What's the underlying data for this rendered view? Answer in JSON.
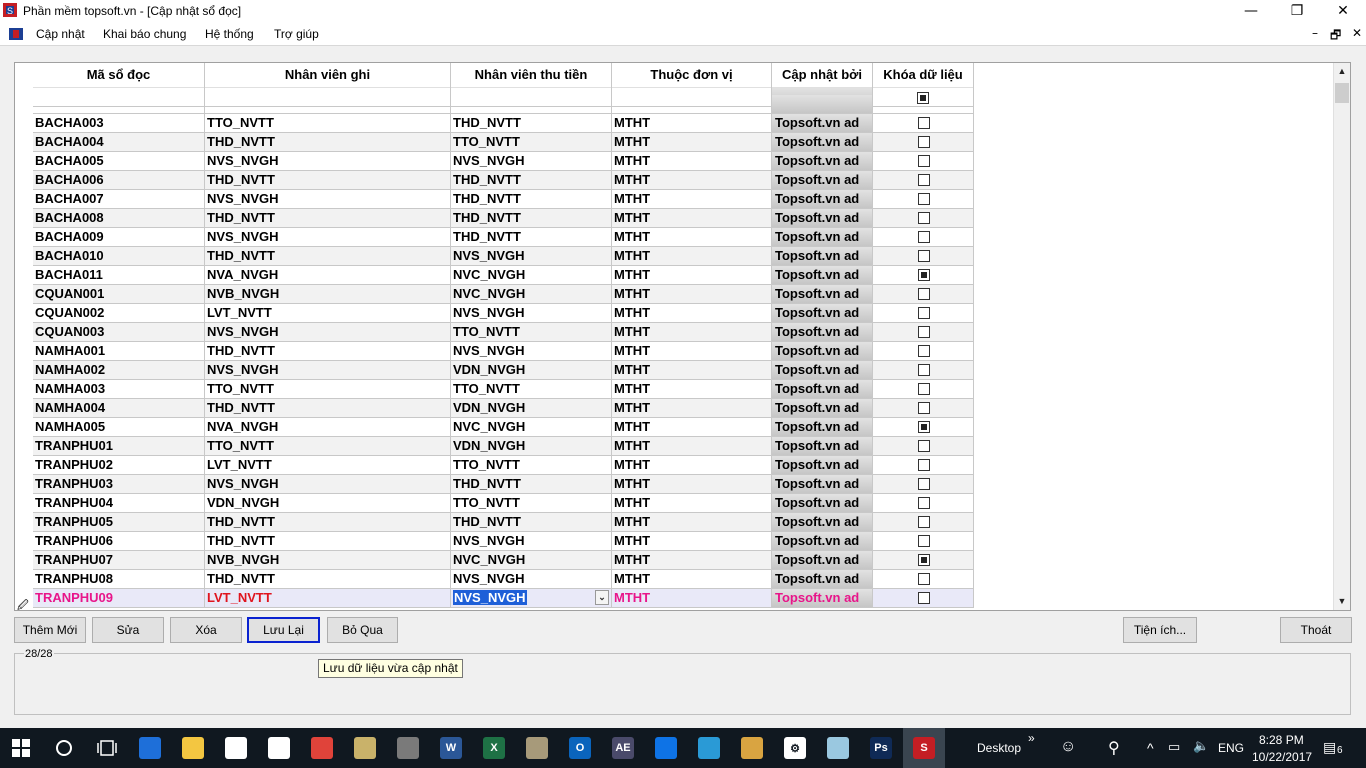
{
  "window": {
    "title": "Phần mềm topsoft.vn - [Cập nhật sổ đọc]",
    "minimize": "—",
    "restore": "❐",
    "close": "✕"
  },
  "menu": {
    "items": [
      "Cập nhật",
      "Khai báo chung",
      "Hệ thống",
      "Trợ giúp"
    ],
    "mdi_minimize": "–",
    "mdi_restore": "🗗",
    "mdi_close": "✕"
  },
  "grid": {
    "columns": [
      "Mã sổ đọc",
      "Nhân viên ghi",
      "Nhân viên thu tiền",
      "Thuộc đơn vị",
      "Cập nhật bởi",
      "Khóa dữ liệu"
    ],
    "header_lock_checked": true,
    "rows": [
      {
        "ma": "BACHA003",
        "nvghi": "TTO_NVTT",
        "nvthu": "THD_NVTT",
        "donvi": "MTHT",
        "capnhat": "Topsoft.vn ad",
        "khoa": false
      },
      {
        "ma": "BACHA004",
        "nvghi": "THD_NVTT",
        "nvthu": "TTO_NVTT",
        "donvi": "MTHT",
        "capnhat": "Topsoft.vn ad",
        "khoa": false
      },
      {
        "ma": "BACHA005",
        "nvghi": "NVS_NVGH",
        "nvthu": "NVS_NVGH",
        "donvi": "MTHT",
        "capnhat": "Topsoft.vn ad",
        "khoa": false
      },
      {
        "ma": "BACHA006",
        "nvghi": "THD_NVTT",
        "nvthu": "THD_NVTT",
        "donvi": "MTHT",
        "capnhat": "Topsoft.vn ad",
        "khoa": false
      },
      {
        "ma": "BACHA007",
        "nvghi": "NVS_NVGH",
        "nvthu": "THD_NVTT",
        "donvi": "MTHT",
        "capnhat": "Topsoft.vn ad",
        "khoa": false
      },
      {
        "ma": "BACHA008",
        "nvghi": "THD_NVTT",
        "nvthu": "THD_NVTT",
        "donvi": "MTHT",
        "capnhat": "Topsoft.vn ad",
        "khoa": false
      },
      {
        "ma": "BACHA009",
        "nvghi": "NVS_NVGH",
        "nvthu": "THD_NVTT",
        "donvi": "MTHT",
        "capnhat": "Topsoft.vn ad",
        "khoa": false
      },
      {
        "ma": "BACHA010",
        "nvghi": "THD_NVTT",
        "nvthu": "NVS_NVGH",
        "donvi": "MTHT",
        "capnhat": "Topsoft.vn ad",
        "khoa": false
      },
      {
        "ma": "BACHA011",
        "nvghi": "NVA_NVGH",
        "nvthu": "NVC_NVGH",
        "donvi": "MTHT",
        "capnhat": "Topsoft.vn ad",
        "khoa": true
      },
      {
        "ma": "CQUAN001",
        "nvghi": "NVB_NVGH",
        "nvthu": "NVC_NVGH",
        "donvi": "MTHT",
        "capnhat": "Topsoft.vn ad",
        "khoa": false
      },
      {
        "ma": "CQUAN002",
        "nvghi": "LVT_NVTT",
        "nvthu": "NVS_NVGH",
        "donvi": "MTHT",
        "capnhat": "Topsoft.vn ad",
        "khoa": false
      },
      {
        "ma": "CQUAN003",
        "nvghi": "NVS_NVGH",
        "nvthu": "TTO_NVTT",
        "donvi": "MTHT",
        "capnhat": "Topsoft.vn ad",
        "khoa": false
      },
      {
        "ma": "NAMHA001",
        "nvghi": "THD_NVTT",
        "nvthu": "NVS_NVGH",
        "donvi": "MTHT",
        "capnhat": "Topsoft.vn ad",
        "khoa": false
      },
      {
        "ma": "NAMHA002",
        "nvghi": "NVS_NVGH",
        "nvthu": "VDN_NVGH",
        "donvi": "MTHT",
        "capnhat": "Topsoft.vn ad",
        "khoa": false
      },
      {
        "ma": "NAMHA003",
        "nvghi": "TTO_NVTT",
        "nvthu": "TTO_NVTT",
        "donvi": "MTHT",
        "capnhat": "Topsoft.vn ad",
        "khoa": false
      },
      {
        "ma": "NAMHA004",
        "nvghi": "THD_NVTT",
        "nvthu": "VDN_NVGH",
        "donvi": "MTHT",
        "capnhat": "Topsoft.vn ad",
        "khoa": false
      },
      {
        "ma": "NAMHA005",
        "nvghi": "NVA_NVGH",
        "nvthu": "NVC_NVGH",
        "donvi": "MTHT",
        "capnhat": "Topsoft.vn ad",
        "khoa": true
      },
      {
        "ma": "TRANPHU01",
        "nvghi": "TTO_NVTT",
        "nvthu": "VDN_NVGH",
        "donvi": "MTHT",
        "capnhat": "Topsoft.vn ad",
        "khoa": false
      },
      {
        "ma": "TRANPHU02",
        "nvghi": "LVT_NVTT",
        "nvthu": "TTO_NVTT",
        "donvi": "MTHT",
        "capnhat": "Topsoft.vn ad",
        "khoa": false
      },
      {
        "ma": "TRANPHU03",
        "nvghi": "NVS_NVGH",
        "nvthu": "THD_NVTT",
        "donvi": "MTHT",
        "capnhat": "Topsoft.vn ad",
        "khoa": false
      },
      {
        "ma": "TRANPHU04",
        "nvghi": "VDN_NVGH",
        "nvthu": "TTO_NVTT",
        "donvi": "MTHT",
        "capnhat": "Topsoft.vn ad",
        "khoa": false
      },
      {
        "ma": "TRANPHU05",
        "nvghi": "THD_NVTT",
        "nvthu": "THD_NVTT",
        "donvi": "MTHT",
        "capnhat": "Topsoft.vn ad",
        "khoa": false
      },
      {
        "ma": "TRANPHU06",
        "nvghi": "THD_NVTT",
        "nvthu": "NVS_NVGH",
        "donvi": "MTHT",
        "capnhat": "Topsoft.vn ad",
        "khoa": false
      },
      {
        "ma": "TRANPHU07",
        "nvghi": "NVB_NVGH",
        "nvthu": "NVC_NVGH",
        "donvi": "MTHT",
        "capnhat": "Topsoft.vn ad",
        "khoa": true
      },
      {
        "ma": "TRANPHU08",
        "nvghi": "THD_NVTT",
        "nvthu": "NVS_NVGH",
        "donvi": "MTHT",
        "capnhat": "Topsoft.vn ad",
        "khoa": false
      }
    ],
    "current_row": {
      "ma": "TRANPHU09",
      "nvghi": "LVT_NVTT",
      "nvthu": "NVS_NVGH",
      "donvi": "MTHT",
      "capnhat": "Topsoft.vn ad",
      "khoa": false
    },
    "row_indicator": "🖉"
  },
  "buttons": {
    "add": "Thêm Mới",
    "edit": "Sửa",
    "delete": "Xóa",
    "save": "Lưu Lại",
    "skip": "Bỏ Qua",
    "utilities": "Tiện ích...",
    "exit": "Thoát"
  },
  "status": {
    "count": "28/28"
  },
  "tooltip": "Lưu dữ liệu vừa cập nhật",
  "taskbar": {
    "apps": [
      "start-icon",
      "search-icon",
      "task-view-icon",
      "edge-icon",
      "file-explorer-icon",
      "store-icon",
      "mail-icon",
      "chrome-icon",
      "tools-icon",
      "build-icon",
      "word-icon",
      "excel-icon",
      "archive-icon",
      "outlook-icon",
      "ae-icon",
      "teamviewer-icon",
      "app-icon",
      "paint-icon",
      "settings-icon",
      "app2-icon",
      "photoshop-icon",
      "topsoft-icon"
    ],
    "desktop_label": "Desktop",
    "desktop_chevron": "»",
    "language": "ENG",
    "time": "8:28 PM",
    "date": "10/22/2017",
    "notifications": "6"
  },
  "colors": {
    "selection_text": "#e8158a",
    "edit_highlight": "#1e5fd8",
    "focus_border": "#0a22d0",
    "taskbar": "#101820"
  }
}
